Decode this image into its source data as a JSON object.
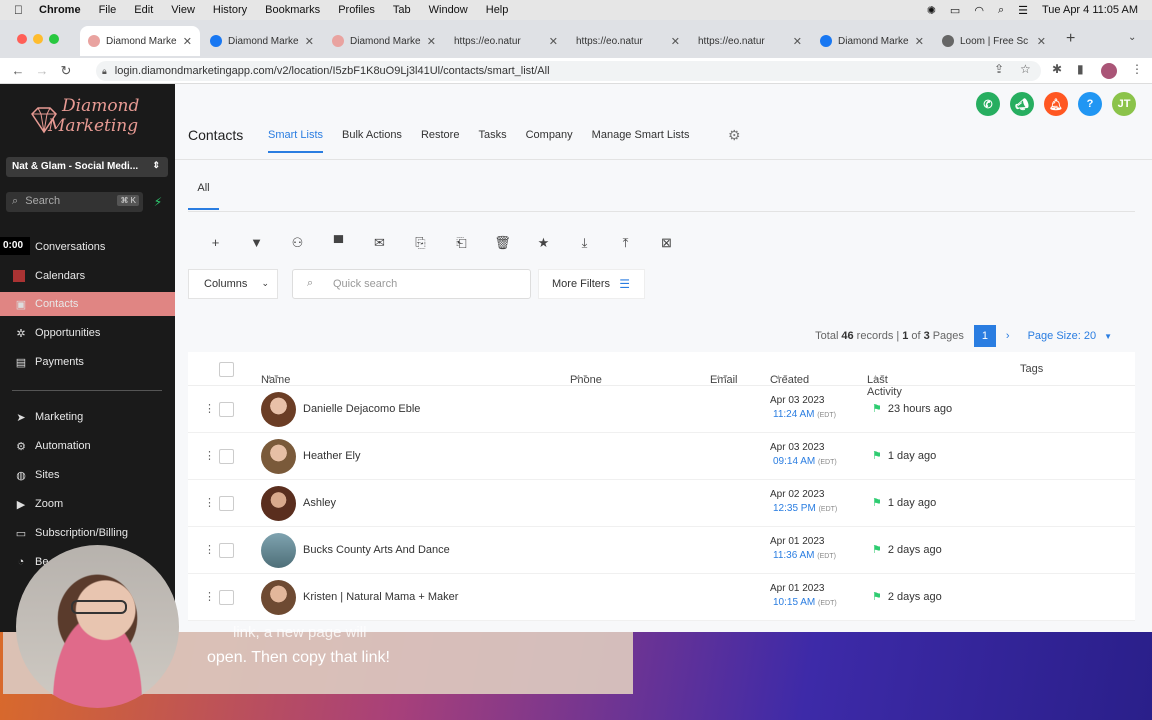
{
  "menubar": {
    "app": "Chrome",
    "items": [
      "File",
      "Edit",
      "View",
      "History",
      "Bookmarks",
      "Profiles",
      "Tab",
      "Window",
      "Help"
    ],
    "clock": "Tue Apr 4  11:05 AM"
  },
  "tabs": [
    {
      "title": "Diamond Marke",
      "active": true
    },
    {
      "title": "Diamond Marke"
    },
    {
      "title": "Diamond Marke"
    },
    {
      "title": "https://eo.natur"
    },
    {
      "title": "https://eo.natur"
    },
    {
      "title": "https://eo.natur"
    },
    {
      "title": "Diamond Marke"
    },
    {
      "title": "Loom | Free Sc"
    }
  ],
  "url": "login.diamondmarketingapp.com/v2/location/I5zbF1K8uO9Lj3l41Ul/contacts/smart_list/All",
  "sidebar": {
    "logo": {
      "line1": "Diamond",
      "line2": "Marketing"
    },
    "location": "Nat & Glam - Social Medi...",
    "search_placeholder": "Search",
    "search_shortcut": "⌘ K",
    "timer": "0:00",
    "items": [
      {
        "label": "Conversations",
        "icon": "chat-icon"
      },
      {
        "label": "Calendars",
        "icon": "calendar-icon"
      },
      {
        "label": "Contacts",
        "icon": "contacts-icon",
        "active": true
      },
      {
        "label": "Opportunities",
        "icon": "opportunities-icon"
      },
      {
        "label": "Payments",
        "icon": "payments-icon"
      },
      {
        "label": "Marketing",
        "icon": "send-icon"
      },
      {
        "label": "Automation",
        "icon": "automation-icon"
      },
      {
        "label": "Sites",
        "icon": "globe-icon"
      },
      {
        "label": "Zoom",
        "icon": "video-icon"
      },
      {
        "label": "Subscription/Billing",
        "icon": "billing-icon"
      },
      {
        "label": "Be",
        "icon": "bell-icon"
      }
    ]
  },
  "header": {
    "title": "Contacts",
    "tabs": [
      "Smart Lists",
      "Bulk Actions",
      "Restore",
      "Tasks",
      "Company",
      "Manage Smart Lists"
    ],
    "avatar_initials": "JT"
  },
  "list_tab": "All",
  "toolbar": {
    "columns_label": "Columns",
    "quick_search_placeholder": "Quick search",
    "more_filters_label": "More Filters"
  },
  "pager": {
    "total_label": "Total",
    "total": "46",
    "records_label": "records |",
    "page": "1",
    "of_label": "of",
    "pages": "3",
    "pages_label": "Pages",
    "current_page": "1",
    "page_size": "Page Size: 20"
  },
  "table": {
    "headers": {
      "name": "Name",
      "phone": "Phone",
      "email": "Email",
      "created": "Created",
      "last_activity": "Last Activity",
      "tags": "Tags"
    },
    "rows": [
      {
        "name": "Danielle Dejacomo Eble",
        "date": "Apr 03 2023",
        "time": "11:24 AM",
        "tz": "(EDT)",
        "activity": "23 hours ago"
      },
      {
        "name": "Heather Ely",
        "date": "Apr 03 2023",
        "time": "09:14 AM",
        "tz": "(EDT)",
        "activity": "1 day ago"
      },
      {
        "name": "Ashley",
        "date": "Apr 02 2023",
        "time": "12:35 PM",
        "tz": "(EDT)",
        "activity": "1 day ago"
      },
      {
        "name": "Bucks County Arts And Dance",
        "date": "Apr 01 2023",
        "time": "11:36 AM",
        "tz": "(EDT)",
        "activity": "2 days ago"
      },
      {
        "name": "Kristen | Natural Mama + Maker",
        "date": "Apr 01 2023",
        "time": "10:15 AM",
        "tz": "(EDT)",
        "activity": "2 days ago"
      }
    ]
  },
  "caption": {
    "line1": "link, a new page will",
    "line2": "open. Then copy that link!"
  },
  "colors": {
    "accent": "#2a7de1",
    "sidebar_active": "#e08583",
    "sidebar_bg": "#1a1a1a"
  }
}
